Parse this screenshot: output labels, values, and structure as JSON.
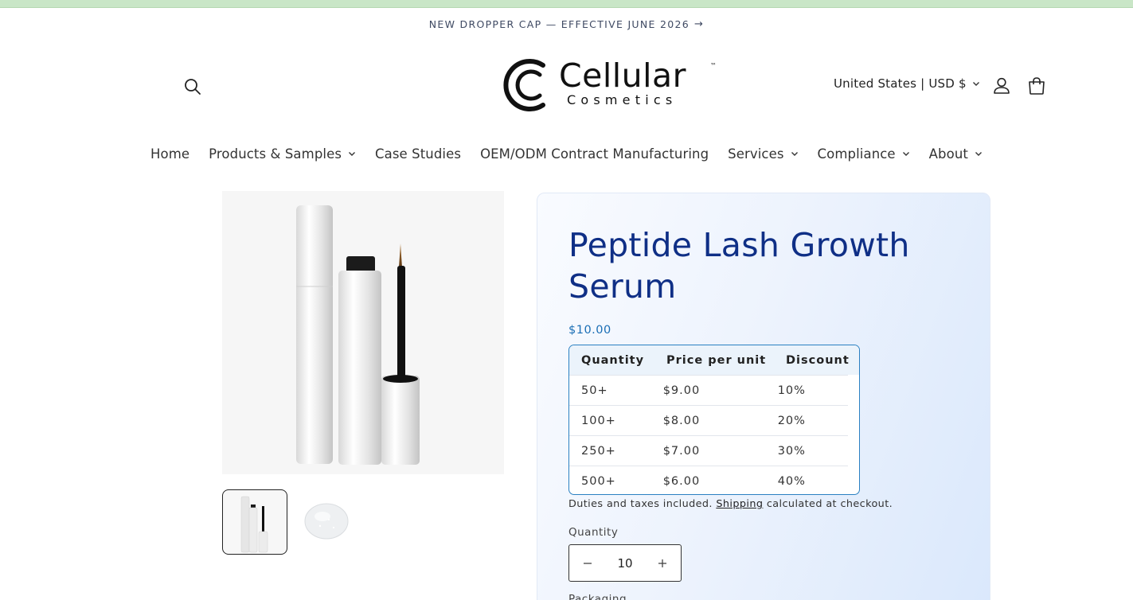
{
  "announcement": {
    "text": "NEW DROPPER CAP — EFFECTIVE JUNE 2026",
    "arrow": "→"
  },
  "header": {
    "logo": {
      "name": "Cellular",
      "sub": "Cosmetics",
      "tm": "™"
    },
    "locale": "United States | USD $",
    "icons": [
      "search-icon",
      "account-icon",
      "cart-icon"
    ]
  },
  "nav": {
    "items": [
      {
        "label": "Home",
        "dropdown": false
      },
      {
        "label": "Products & Samples",
        "dropdown": true
      },
      {
        "label": "Case Studies",
        "dropdown": false
      },
      {
        "label": "OEM/ODM Contract Manufacturing",
        "dropdown": false
      },
      {
        "label": "Services",
        "dropdown": true
      },
      {
        "label": "Compliance",
        "dropdown": true
      },
      {
        "label": "About",
        "dropdown": true
      }
    ]
  },
  "product": {
    "title": "Peptide Lash Growth Serum",
    "price": "$10.00",
    "tiers": {
      "headers": [
        "Quantity",
        "Price per unit",
        "Discount"
      ],
      "rows": [
        [
          "50+",
          "$9.00",
          "10%"
        ],
        [
          "100+",
          "$8.00",
          "20%"
        ],
        [
          "250+",
          "$7.00",
          "30%"
        ],
        [
          "500+",
          "$6.00",
          "40%"
        ]
      ]
    },
    "tax_note": {
      "before": "Duties and taxes included.",
      "link": "Shipping",
      "after": "calculated at checkout."
    },
    "quantity_label": "Quantity",
    "quantity_value": "10",
    "packaging_label": "Packaging"
  },
  "colors": {
    "title": "#0f2f86",
    "price": "#1a6eb5",
    "table_border": "#2a80c2",
    "top_strip": "#c9e6c7"
  }
}
